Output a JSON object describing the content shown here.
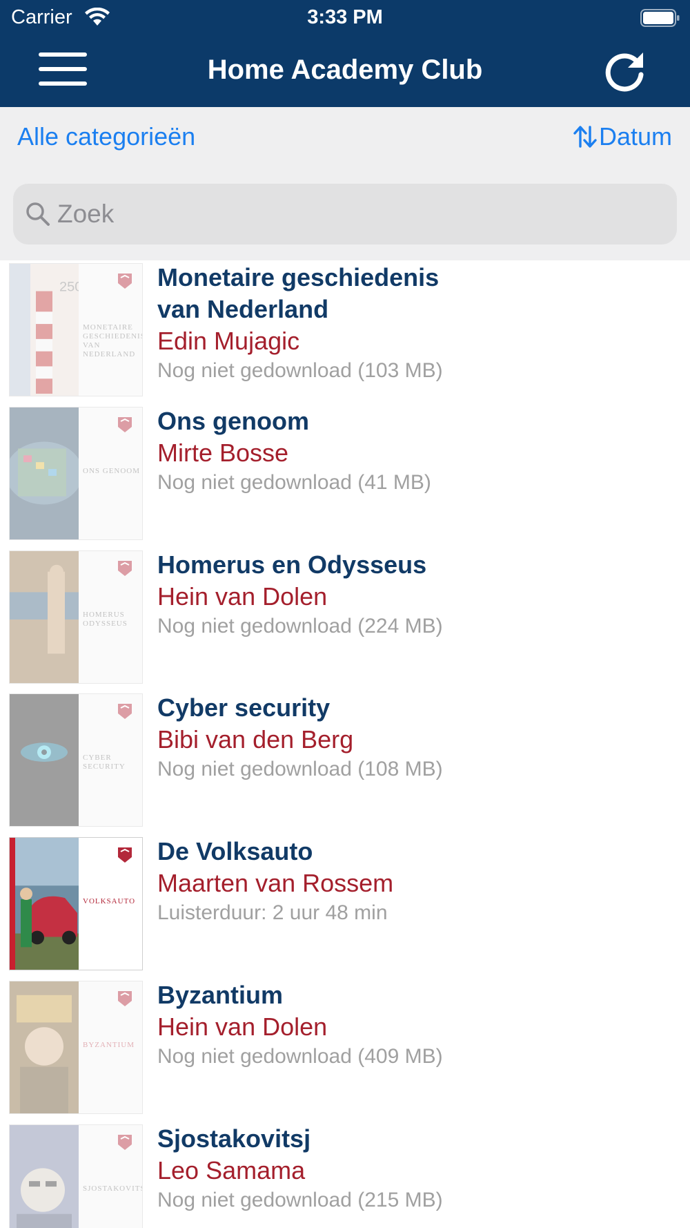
{
  "status_bar": {
    "carrier": "Carrier",
    "time": "3:33 PM"
  },
  "nav": {
    "title": "Home Academy Club",
    "menu_icon": "hamburger-menu-icon",
    "refresh_icon": "refresh-icon"
  },
  "filters": {
    "category_label": "Alle categorieën",
    "sort_label": "Datum",
    "sort_icon": "sort-arrows-icon"
  },
  "search": {
    "placeholder": "Zoek",
    "value": ""
  },
  "colors": {
    "header": "#0c3a69",
    "link": "#1b7ff0",
    "title": "#113a66",
    "author": "#a41f2c",
    "status": "#a0a0a0"
  },
  "books": [
    {
      "title": "Monetaire geschiedenis van Nederland",
      "author": "Edin Mujagic",
      "status": "Nog niet gedownload (103 MB)",
      "cover_title": "MONETAIRE GESCHIEDENIS VAN NEDERLAND",
      "downloaded": false
    },
    {
      "title": "Ons genoom",
      "author": "Mirte Bosse",
      "status": "Nog niet gedownload (41 MB)",
      "cover_title": "ONS GENOOM",
      "downloaded": false
    },
    {
      "title": "Homerus en Odysseus",
      "author": "Hein van Dolen",
      "status": "Nog niet gedownload (224 MB)",
      "cover_title": "HOMERUS ODYSSEUS",
      "downloaded": false
    },
    {
      "title": "Cyber security",
      "author": "Bibi van den Berg",
      "status": "Nog niet gedownload (108 MB)",
      "cover_title": "CYBER SECURITY",
      "downloaded": false
    },
    {
      "title": "De Volksauto",
      "author": "Maarten van Rossem",
      "status": "Luisterduur: 2 uur 48 min",
      "cover_title": "VOLKSAUTO",
      "downloaded": true
    },
    {
      "title": "Byzantium",
      "author": "Hein van Dolen",
      "status": "Nog niet gedownload (409 MB)",
      "cover_title": "BYZANTIUM",
      "downloaded": false
    },
    {
      "title": "Sjostakovitsj",
      "author": "Leo Samama",
      "status": "Nog niet gedownload (215 MB)",
      "cover_title": "SJOSTAKOVITSJ",
      "downloaded": false
    }
  ]
}
